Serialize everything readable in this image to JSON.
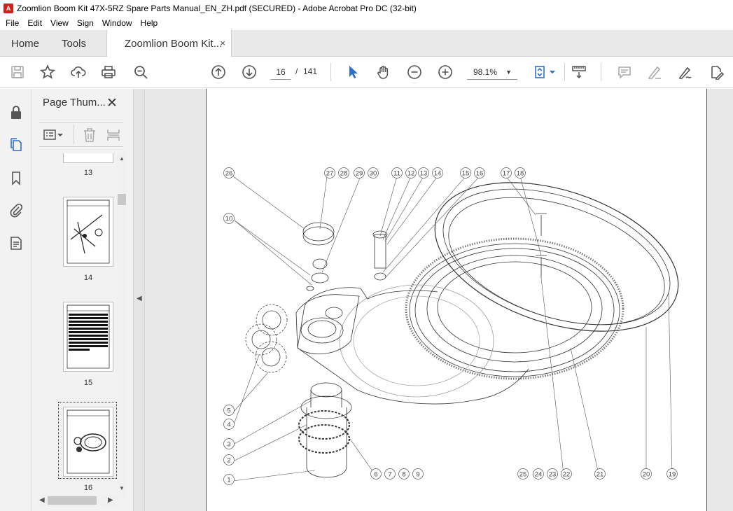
{
  "window": {
    "title": "Zoomlion Boom Kit 47X-5RZ Spare Parts Manual_EN_ZH.pdf (SECURED) - Adobe Acrobat Pro DC (32-bit)"
  },
  "menu": [
    "File",
    "Edit",
    "View",
    "Sign",
    "Window",
    "Help"
  ],
  "tabs": {
    "home": "Home",
    "tools": "Tools",
    "doc": "Zoomlion Boom Kit...",
    "close": "×"
  },
  "toolbar": {
    "page_current": "16",
    "page_sep": "/",
    "page_total": "141",
    "zoom": "98.1%"
  },
  "panel": {
    "title": "Page Thum...",
    "close": "✕",
    "thumbs": [
      "13",
      "14",
      "15",
      "16"
    ],
    "selected": "16"
  },
  "callouts": {
    "top": [
      "26",
      "27",
      "28",
      "29",
      "30",
      "11",
      "12",
      "13",
      "14",
      "15",
      "16",
      "17",
      "18"
    ],
    "left": [
      "10",
      "5",
      "4",
      "3",
      "2",
      "1"
    ],
    "bottom": [
      "6",
      "7",
      "8",
      "9",
      "25",
      "24",
      "23",
      "22",
      "21",
      "20",
      "19"
    ]
  },
  "colors": {
    "accent": "#2c6fd1",
    "tabbar": "#e9e9e9",
    "rail": "#f2f2f2",
    "pdf_red": "#d0201b"
  }
}
